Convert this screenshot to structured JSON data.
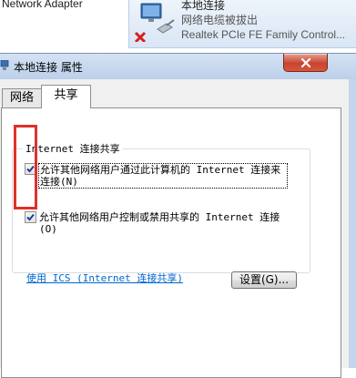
{
  "background": {
    "left_text": "Network Adapter",
    "connection": {
      "name": "本地连接",
      "status": "网络电缆被拔出",
      "device": "Realtek PCIe FE Family Control..."
    }
  },
  "dialog": {
    "title": "本地连接 属性",
    "close_label": "✕",
    "tabs": [
      {
        "label": "网络",
        "selected": false
      },
      {
        "label": "共享",
        "selected": true
      }
    ],
    "group_title": "Internet 连接共享",
    "options": [
      {
        "checked": true,
        "text": "允许其他网络用户通过此计算机的 Internet 连接来连接(N)"
      },
      {
        "checked": true,
        "text": "允许其他网络用户控制或禁用共享的 Internet 连接(O)"
      }
    ],
    "ics_link": "使用 ICS (Internet 连接共享)",
    "settings_button": "设置(G)..."
  },
  "colors": {
    "highlight": "#e0302b",
    "link": "#0066cc",
    "close_button": "#c7452f"
  }
}
